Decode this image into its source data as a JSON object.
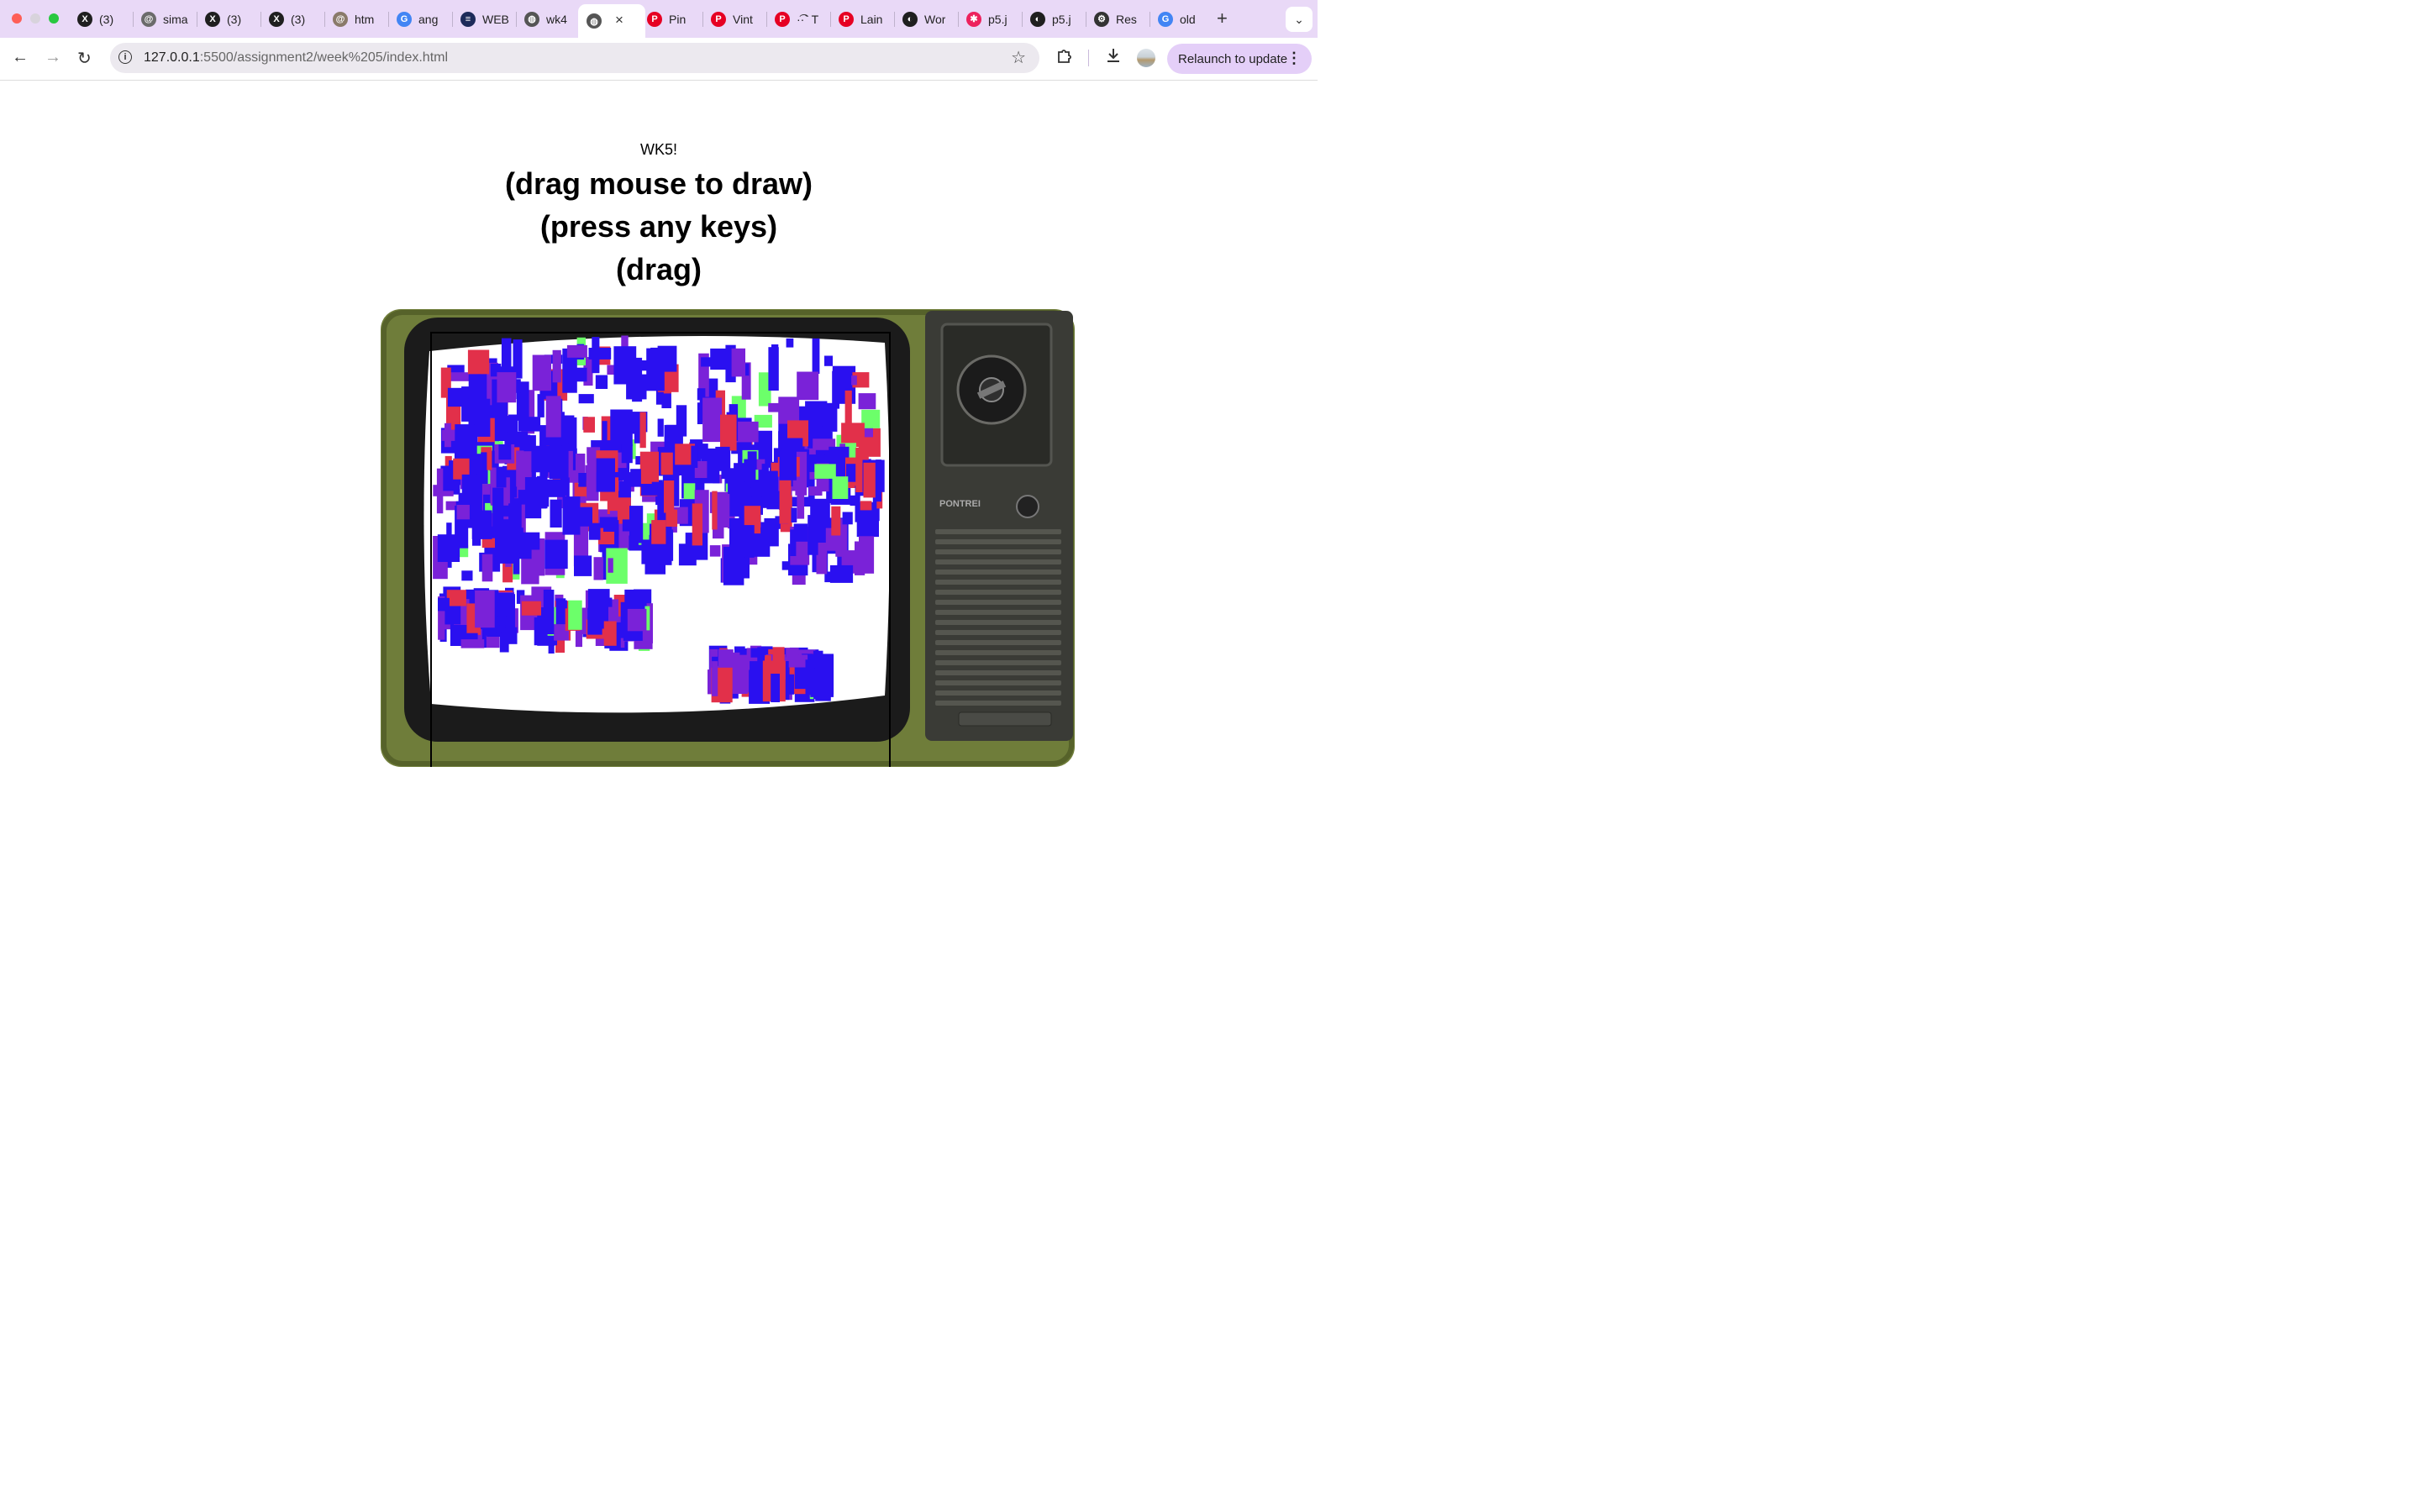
{
  "browser": {
    "tabs": [
      {
        "label": "(3) ",
        "icon": "brand-x-icon",
        "color": "#1f1f1f"
      },
      {
        "label": "sima",
        "icon": "spiral-icon",
        "color": "#6b6b6b"
      },
      {
        "label": "(3) ",
        "icon": "brand-x-icon",
        "color": "#1f1f1f"
      },
      {
        "label": "(3) ",
        "icon": "brand-x-icon",
        "color": "#1f1f1f"
      },
      {
        "label": "htm",
        "icon": "spiral-icon",
        "color": "#8a7a6a"
      },
      {
        "label": "ang",
        "icon": "google-icon",
        "color": "#4285f4"
      },
      {
        "label": "WEB",
        "icon": "app-icon",
        "color": "#1d2b5a"
      },
      {
        "label": "wk4",
        "icon": "globe-icon",
        "color": "#555555"
      },
      {
        "label": "",
        "icon": "globe-icon",
        "color": "#555555",
        "active": true
      },
      {
        "label": "Pin",
        "icon": "pinterest-icon",
        "color": "#e60023"
      },
      {
        "label": "Vint",
        "icon": "pinterest-icon",
        "color": "#e60023"
      },
      {
        "label": "·͡·` T",
        "icon": "pinterest-icon",
        "color": "#e60023"
      },
      {
        "label": "Lain",
        "icon": "pinterest-icon",
        "color": "#e60023"
      },
      {
        "label": "Wor",
        "icon": "github-icon",
        "color": "#1f1f1f"
      },
      {
        "label": "p5.j",
        "icon": "asterisk-icon",
        "color": "#ed225d"
      },
      {
        "label": "p5.j",
        "icon": "github-icon",
        "color": "#1f1f1f"
      },
      {
        "label": "Res",
        "icon": "openai-icon",
        "color": "#333333"
      },
      {
        "label": "old",
        "icon": "google-icon",
        "color": "#4285f4"
      }
    ],
    "url_host": "127.0.0.1",
    "url_path": ":5500/assignment2/week%205/index.html",
    "relaunch_label": "Relaunch to update"
  },
  "page": {
    "title": "WK5!",
    "instructions": [
      "(drag mouse to draw)",
      "(press any keys)",
      "(drag)"
    ]
  },
  "tv": {
    "brand": "PONTREI",
    "body_color": "#6f7d3a",
    "screen_colors": [
      "#2a10f0",
      "#7a22d8",
      "#e2304a",
      "#6cff6a"
    ]
  }
}
